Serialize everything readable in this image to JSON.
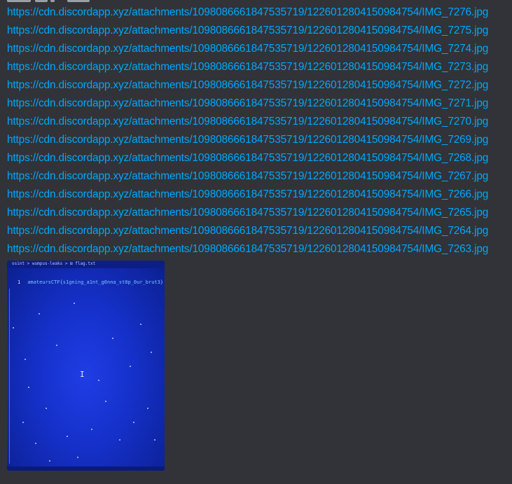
{
  "message": {
    "links": [
      "https://cdn.discordapp.xyz/attachments/1098086661847535719/1226012804150984754/IMG_7276.jpg",
      "https://cdn.discordapp.xyz/attachments/1098086661847535719/1226012804150984754/IMG_7275.jpg",
      "https://cdn.discordapp.xyz/attachments/1098086661847535719/1226012804150984754/IMG_7274.jpg",
      "https://cdn.discordapp.xyz/attachments/1098086661847535719/1226012804150984754/IMG_7273.jpg",
      "https://cdn.discordapp.xyz/attachments/1098086661847535719/1226012804150984754/IMG_7272.jpg",
      "https://cdn.discordapp.xyz/attachments/1098086661847535719/1226012804150984754/IMG_7271.jpg",
      "https://cdn.discordapp.xyz/attachments/1098086661847535719/1226012804150984754/IMG_7270.jpg",
      "https://cdn.discordapp.xyz/attachments/1098086661847535719/1226012804150984754/IMG_7269.jpg",
      "https://cdn.discordapp.xyz/attachments/1098086661847535719/1226012804150984754/IMG_7268.jpg",
      "https://cdn.discordapp.xyz/attachments/1098086661847535719/1226012804150984754/IMG_7267.jpg",
      "https://cdn.discordapp.xyz/attachments/1098086661847535719/1226012804150984754/IMG_7266.jpg",
      "https://cdn.discordapp.xyz/attachments/1098086661847535719/1226012804150984754/IMG_7265.jpg",
      "https://cdn.discordapp.xyz/attachments/1098086661847535719/1226012804150984754/IMG_7264.jpg",
      "https://cdn.discordapp.xyz/attachments/1098086661847535719/1226012804150984754/IMG_7263.jpg"
    ],
    "attachment": {
      "breadcrumb": "osint > wumpus-leaks > ⊞ flag.txt",
      "line_number": "1",
      "code": "amateursCTF{s1gning_a1nt_g0nna_st0p_0ur_brut3}",
      "cursor": "I"
    }
  },
  "colors": {
    "background": "#313338",
    "link": "#00a8fc",
    "photo_blue": "#1530c8"
  }
}
